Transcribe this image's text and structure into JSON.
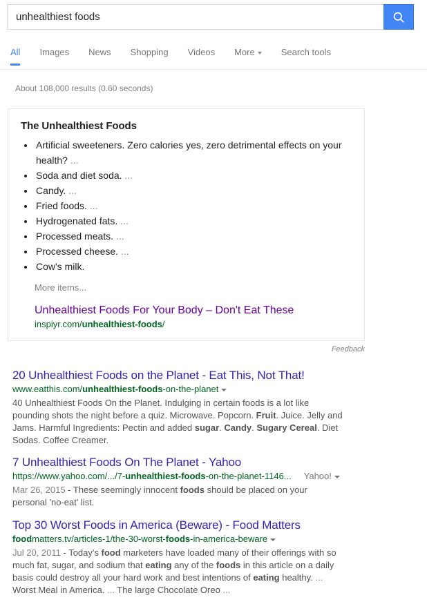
{
  "search": {
    "query": "unhealthiest foods",
    "placeholder": "Search",
    "button_icon": "search-icon",
    "button_color": "#4285f4"
  },
  "nav": {
    "tabs": [
      {
        "label": "All",
        "active": true
      },
      {
        "label": "Images",
        "active": false
      },
      {
        "label": "News",
        "active": false
      },
      {
        "label": "Shopping",
        "active": false
      },
      {
        "label": "Videos",
        "active": false
      },
      {
        "label": "More",
        "active": false,
        "has_caret": true
      },
      {
        "label": "Search tools",
        "active": false
      }
    ],
    "active_color": "#4285f4"
  },
  "result_stats": "About 108,000 results (0.60 seconds)",
  "featured_snippet": {
    "title": "The Unhealthiest Foods",
    "items": [
      {
        "text": "Artificial sweeteners. Zero calories yes, zero detrimental effects on your health?",
        "ellipsis": "..."
      },
      {
        "text": "Soda and diet soda.",
        "ellipsis": "..."
      },
      {
        "text": "Candy.",
        "ellipsis": "..."
      },
      {
        "text": "Fried foods.",
        "ellipsis": "..."
      },
      {
        "text": "Hydrogenated fats.",
        "ellipsis": "..."
      },
      {
        "text": "Processed meats.",
        "ellipsis": "..."
      },
      {
        "text": "Processed cheese.",
        "ellipsis": "..."
      },
      {
        "text": "Cow's milk.",
        "ellipsis": ""
      }
    ],
    "more_items": "More items...",
    "source_title": "Unhealthiest Foods For Your Body – Don't Eat These",
    "source_url_pre": "inspiyr.com/",
    "source_url_bold": "unhealthiest-foods",
    "source_url_post": "/",
    "source_title_color": "#660099",
    "url_color": "#006621",
    "feedback_label": "Feedback"
  },
  "results": [
    {
      "title": "20 Unhealthiest Foods on the Planet - Eat This, Not That!",
      "url_pre": "www.eatthis.com/",
      "url_bold": "unhealthiest-foods",
      "url_post": "-on-the-planet",
      "site_label": "",
      "date": "",
      "snippet_html": "40 Unhealthiest Foods On the Planet. Indulging in certain foods is a lot like pounding shots the night before a quiz. Microwave. Popcorn. <b>Fruit</b>. Juice. Jelly and Jams. Harmful Ingredients: Pectin and added <b>sugar</b>. <b>Candy</b>. <b>Sugary Cereal</b>. Diet Sodas. Coffee Creamer."
    },
    {
      "title": "7 Unhealthiest Foods On The Planet - Yahoo",
      "url_pre": "https://www.yahoo.com/.../7-",
      "url_bold": "unhealthiest-foods",
      "url_post": "-on-the-planet-1146...",
      "site_label": "Yahoo!",
      "date": "Mar 26, 2015",
      "snippet_html": "These seemingly innocent <b>foods</b> should be placed on your personal 'no-eat' list."
    },
    {
      "title": "Top 30 Worst Foods in America (Beware) - Food Matters",
      "url_pre": "",
      "url_bold": "food",
      "url_post": "matters.tv/articles-1/the-30-worst-",
      "url_bold2": "foods",
      "url_post2": "-in-america-beware",
      "site_label": "",
      "date": "Jul 20, 2011",
      "snippet_html": "Today's <b>food</b> marketers have loaded many of their offerings with so much fat, sugar, and sodium that <b>eating</b> any of the <b>foods</b> in this article on a daily basis could destroy all your hard work and best intentions of <b>eating</b> healthy. <span class=\"ell\">...</span> Worst Meal in America. <span class=\"ell\">...</span> The large Chocolate Oreo <span class=\"ell\">...</span>"
    }
  ]
}
